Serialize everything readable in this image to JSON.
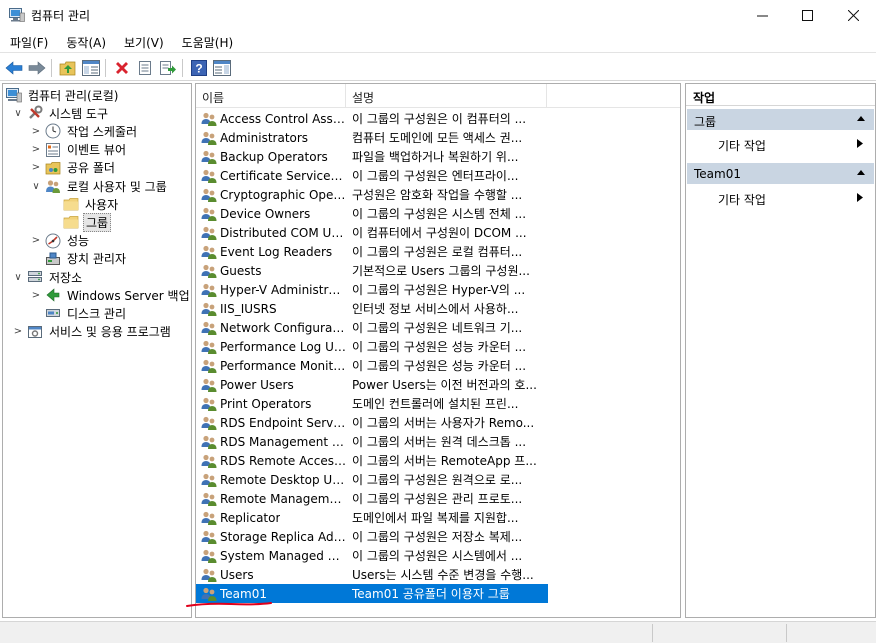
{
  "window": {
    "title": "컴퓨터 관리",
    "minimize_icon": "minimize-icon",
    "maximize_icon": "maximize-icon",
    "close_icon": "close-icon"
  },
  "menu": [
    "파일(F)",
    "동작(A)",
    "보기(V)",
    "도움말(H)"
  ],
  "toolbar": [
    "back-arrow-icon",
    "forward-arrow-icon",
    "up-folder-icon",
    "show-hide-tree-icon",
    "delete-icon",
    "properties-icon",
    "export-icon",
    "help-icon",
    "action-pane-icon"
  ],
  "tree": [
    {
      "label": "컴퓨터 관리(로컬)",
      "level": 0,
      "expander": "",
      "icon": "computer-management-icon"
    },
    {
      "label": "시스템 도구",
      "level": 1,
      "expander": "∨",
      "icon": "system-tools-icon"
    },
    {
      "label": "작업 스케줄러",
      "level": 2,
      "expander": ">",
      "icon": "clock-icon"
    },
    {
      "label": "이벤트 뷰어",
      "level": 2,
      "expander": ">",
      "icon": "event-viewer-icon"
    },
    {
      "label": "공유 폴더",
      "level": 2,
      "expander": ">",
      "icon": "shared-folder-icon"
    },
    {
      "label": "로컬 사용자 및 그룹",
      "level": 2,
      "expander": "∨",
      "icon": "users-groups-icon"
    },
    {
      "label": "사용자",
      "level": 3,
      "expander": "",
      "icon": "folder-icon"
    },
    {
      "label": "그룹",
      "level": 3,
      "expander": "",
      "icon": "folder-icon",
      "selected": true
    },
    {
      "label": "성능",
      "level": 2,
      "expander": ">",
      "icon": "performance-icon"
    },
    {
      "label": "장치 관리자",
      "level": 2,
      "expander": "",
      "icon": "device-manager-icon"
    },
    {
      "label": "저장소",
      "level": 1,
      "expander": "∨",
      "icon": "storage-icon"
    },
    {
      "label": "Windows Server 백업",
      "level": 2,
      "expander": ">",
      "icon": "backup-icon"
    },
    {
      "label": "디스크 관리",
      "level": 2,
      "expander": "",
      "icon": "disk-icon"
    },
    {
      "label": "서비스 및 응용 프로그램",
      "level": 1,
      "expander": ">",
      "icon": "services-icon"
    }
  ],
  "list": {
    "columns": [
      "이름",
      "설명"
    ],
    "rows": [
      {
        "name": "Access Control Assist...",
        "desc": "이 그룹의 구성원은 이 컴퓨터의 ..."
      },
      {
        "name": "Administrators",
        "desc": "컴퓨터 도메인에 모든 액세스 권..."
      },
      {
        "name": "Backup Operators",
        "desc": "파일을 백업하거나 복원하기 위..."
      },
      {
        "name": "Certificate Service DC...",
        "desc": "이 그룹의 구성원은 엔터프라이..."
      },
      {
        "name": "Cryptographic Operat...",
        "desc": "구성원은 암호화 작업을 수행할 ..."
      },
      {
        "name": "Device Owners",
        "desc": "이 그룹의 구성원은 시스템 전체 ..."
      },
      {
        "name": "Distributed COM Users",
        "desc": "이 컴퓨터에서 구성원이 DCOM ..."
      },
      {
        "name": "Event Log Readers",
        "desc": "이 그룹의 구성원은 로컬 컴퓨터..."
      },
      {
        "name": "Guests",
        "desc": "기본적으로 Users 그룹의 구성원..."
      },
      {
        "name": "Hyper-V Administrat...",
        "desc": "이 그룹의 구성원은 Hyper-V의 ..."
      },
      {
        "name": "IIS_IUSRS",
        "desc": "인터넷 정보 서비스에서 사용하..."
      },
      {
        "name": "Network Configuratio...",
        "desc": "이 그룹의 구성원은 네트워크 기..."
      },
      {
        "name": "Performance Log Users",
        "desc": "이 그룹의 구성원은 성능 카운터 ..."
      },
      {
        "name": "Performance Monitor...",
        "desc": "이 그룹의 구성원은 성능 카운터 ..."
      },
      {
        "name": "Power Users",
        "desc": "Power Users는 이전 버전과의 호..."
      },
      {
        "name": "Print Operators",
        "desc": "도메인 컨트롤러에 설치된 프린..."
      },
      {
        "name": "RDS Endpoint Servers",
        "desc": "이 그룹의 서버는 사용자가 Remo..."
      },
      {
        "name": "RDS Management Se...",
        "desc": "이 그룹의 서버는 원격 데스크톱 ..."
      },
      {
        "name": "RDS Remote Access ...",
        "desc": "이 그룹의 서버는 RemoteApp 프..."
      },
      {
        "name": "Remote Desktop Users",
        "desc": "이 그룹의 구성원은 원격으로 로..."
      },
      {
        "name": "Remote Management...",
        "desc": "이 그룹의 구성원은 관리 프로토..."
      },
      {
        "name": "Replicator",
        "desc": "도메인에서 파일 복제를 지원합..."
      },
      {
        "name": "Storage Replica Admi...",
        "desc": "이 그룹의 구성원은 저장소 복제..."
      },
      {
        "name": "System Managed Acc...",
        "desc": "이 그룹의 구성원은 시스템에서 ..."
      },
      {
        "name": "Users",
        "desc": "Users는 시스템 수준 변경을 수행..."
      },
      {
        "name": "Team01",
        "desc": "Team01 공유폴더 이용자 그룹",
        "selected": true
      }
    ]
  },
  "actions": {
    "header": "작업",
    "sections": [
      {
        "title": "그룹",
        "item": "기타 작업"
      },
      {
        "title": "Team01",
        "item": "기타 작업"
      }
    ]
  },
  "colors": {
    "selection": "#0078d7",
    "section_header": "#c9d5e2",
    "annotation": "#e0001b"
  }
}
